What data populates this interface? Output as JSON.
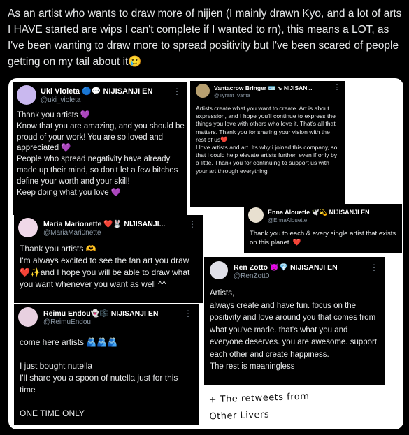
{
  "caption": "As an artist who wants to draw more of nijien (I mainly drawn Kyo, and a lot of arts I HAVE started are wips I can't complete if I wanted to rn), this means a LOT, as I've been wanting to draw more to spread positivity but I've been scared of people getting on my tail about it🥲",
  "cards": {
    "uki": {
      "name": "Uki Violeta 🔵💬 NIJISANJI EN",
      "handle": "@uki_violeta",
      "text": "Thank you artists 💜\nKnow that you are amazing, and you should be proud of your work! You are so loved and appreciated 💜\nPeople who spread negativity have already made up their mind, so don't let a few bitches define your worth and your skill!\nKeep doing what you love 💜"
    },
    "vanta": {
      "name": "Vantacrow Bringer 🪪 ↘ NIJISAN...",
      "handle": "@Tyrant_Vanta",
      "text": "Artists create what you want to create. Art is about expression, and I hope you'll continue to express the things you love with others who love it. That's all that matters. Thank you for sharing your vision with the rest of us❤️\nI love artists and art. Its why i joined this company, so that i could help elevate artists further, even if only by a little. Thank you for continuing to support us with your art through everything"
    },
    "maria": {
      "name": "Maria Marionette ❤️🐰 NIJISANJI...",
      "handle": "@MariaMari0nette",
      "text": "Thank you artists 🫶\nI'm always excited to see the fan art you draw ❤️✨and I hope you will be able to draw what you want whenever you want as well ^^"
    },
    "enna": {
      "name": "Enna Alouette 🕊️💫 NIJISANJI EN",
      "handle": "@EnnaAlouette",
      "text": "Thank you to each & every single artist that exists on this planet. ❤️"
    },
    "ren": {
      "name": "Ren Zotto 😈💎 NIJISANJI EN",
      "handle": "@RenZott0",
      "text": "Artists,\nalways create and have fun. focus on the positivity and love around you that comes from what you've made. that's what you and everyone deserves. you are awesome. support each other and create happiness.\nThe rest is meaningless"
    },
    "reimu": {
      "name": "Reimu Endou👻🎼 NIJISANJI EN",
      "handle": "@ReimuEndou",
      "text": "come here artists 🫂🫂🫂\n\nI just bought nutella\nI'll share you a spoon of nutella just for this time\n\nONE TIME ONLY"
    }
  },
  "handwritten": "+ The retweets from\nOther Livers",
  "more_icon": "more-dots-icon"
}
